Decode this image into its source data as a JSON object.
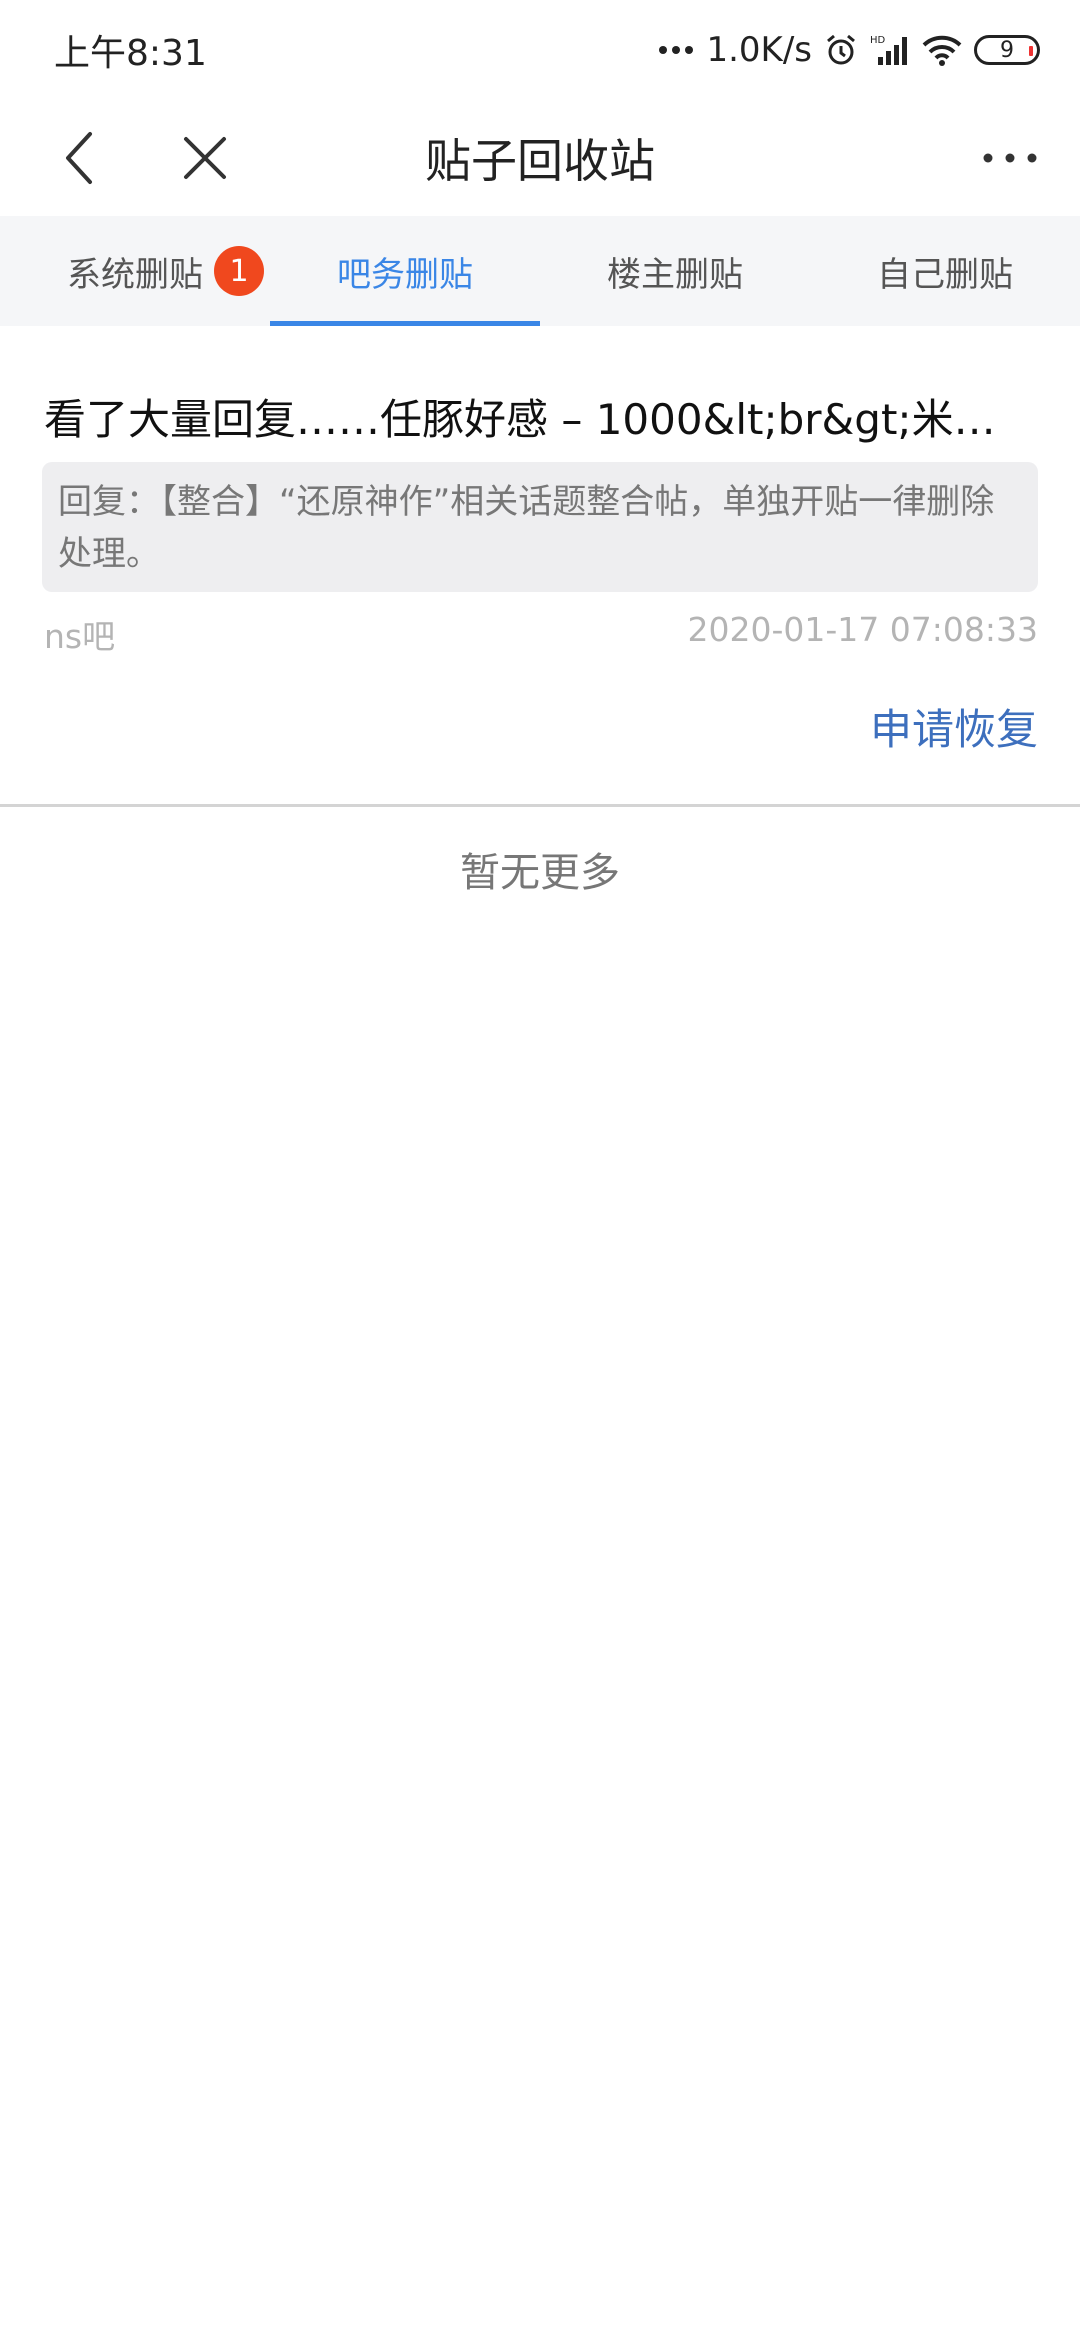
{
  "status_bar": {
    "time": "上午8:31",
    "net_speed": "1.0K/s",
    "battery_level": "9"
  },
  "nav": {
    "title": "贴子回收站"
  },
  "tabs": [
    {
      "label": "系统删贴",
      "badge": "1"
    },
    {
      "label": "吧务删贴",
      "active": true
    },
    {
      "label": "楼主删贴"
    },
    {
      "label": "自己删贴"
    }
  ],
  "post": {
    "title": "看了大量回复……任豚好感 – 1000&lt;br&gt;米…",
    "reply": "回复：【整合】“还原神作”相关话题整合帖，单独开贴一律删除处理。",
    "forum": "ns吧",
    "time": "2020-01-17 07:08:33",
    "restore_label": "申请恢复"
  },
  "footer": {
    "no_more": "暂无更多"
  },
  "colors": {
    "accent": "#3a86e6",
    "badge": "#f0481e",
    "restore_link": "#3d6fbd"
  }
}
